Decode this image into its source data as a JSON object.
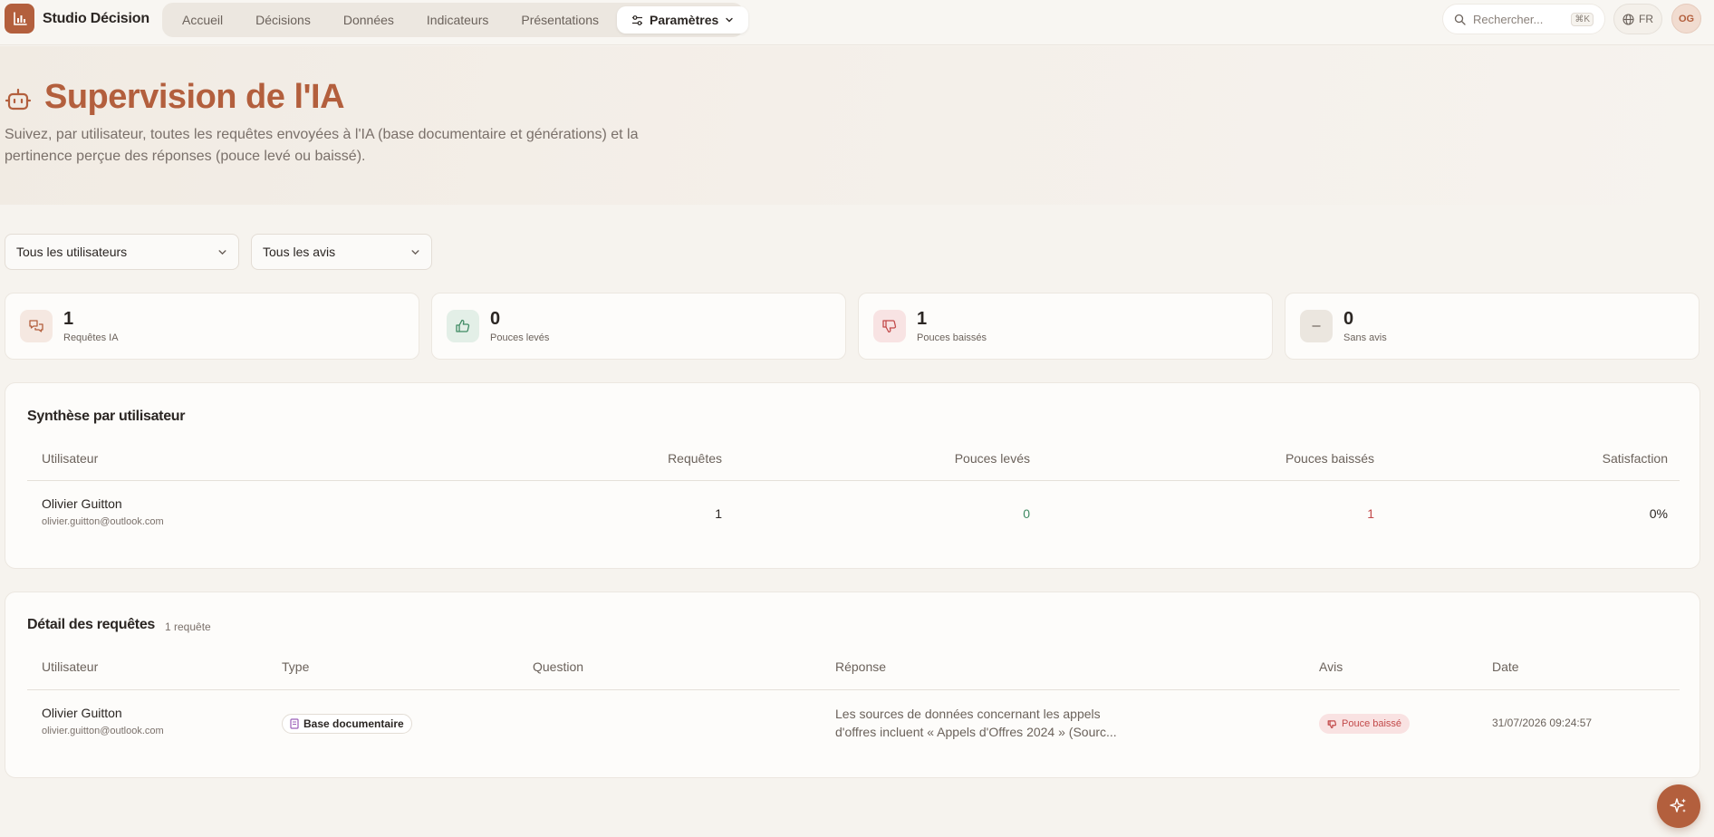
{
  "app": {
    "brand": "Studio Décision",
    "brand_icon": "bar-chart-icon"
  },
  "nav": {
    "items": [
      {
        "label": "Accueil"
      },
      {
        "label": "Décisions"
      },
      {
        "label": "Données"
      },
      {
        "label": "Indicateurs"
      },
      {
        "label": "Présentations"
      },
      {
        "label": "Paramètres",
        "active": true,
        "icon": "sliders-icon"
      }
    ]
  },
  "search": {
    "placeholder": "Rechercher...",
    "shortcut": "⌘K"
  },
  "lang": {
    "code": "FR"
  },
  "user": {
    "initials": "OG"
  },
  "hero": {
    "title": "Supervision de l'IA",
    "subtitle": "Suivez, par utilisateur, toutes les requêtes envoyées à l'IA (base documentaire et générations) et la pertinence perçue des réponses (pouce levé ou baissé)."
  },
  "filters": {
    "users": "Tous les utilisateurs",
    "avis": "Tous les avis"
  },
  "stats": [
    {
      "value": "1",
      "label": "Requêtes IA",
      "icon": "chat-icon"
    },
    {
      "value": "0",
      "label": "Pouces levés",
      "icon": "thumbs-up-icon"
    },
    {
      "value": "1",
      "label": "Pouces baissés",
      "icon": "thumbs-down-icon"
    },
    {
      "value": "0",
      "label": "Sans avis",
      "icon": "minus-icon"
    }
  ],
  "summary": {
    "title": "Synthèse par utilisateur",
    "headers": {
      "user": "Utilisateur",
      "requests": "Requêtes",
      "up": "Pouces levés",
      "down": "Pouces baissés",
      "satisfaction": "Satisfaction"
    },
    "rows": [
      {
        "name": "Olivier Guitton",
        "email": "olivier.guitton@outlook.com",
        "requests": "1",
        "up": "0",
        "down": "1",
        "satisfaction": "0%"
      }
    ]
  },
  "detail": {
    "title": "Détail des requêtes",
    "count": "1 requête",
    "headers": {
      "user": "Utilisateur",
      "type": "Type",
      "question": "Question",
      "response": "Réponse",
      "avis": "Avis",
      "date": "Date"
    },
    "rows": [
      {
        "name": "Olivier Guitton",
        "email": "olivier.guitton@outlook.com",
        "type": "Base documentaire",
        "question": "",
        "response_line1": "Les sources de données concernant les appels",
        "response_line2": "d'offres incluent « Appels d'Offres 2024 » (Sourc...",
        "avis": "Pouce baissé",
        "date": "31/07/2026 09:24:57"
      }
    ]
  },
  "colors": {
    "accent": "#b35f3d",
    "positive": "#3f8a63",
    "negative": "#c24a4a"
  }
}
